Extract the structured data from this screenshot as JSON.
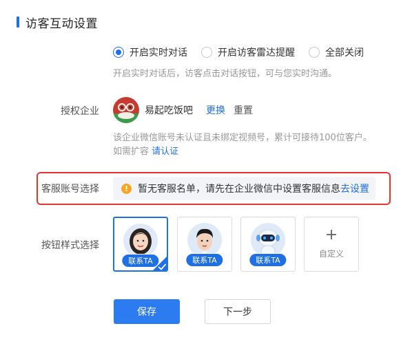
{
  "section": {
    "title": "访客互动设置"
  },
  "mode": {
    "options": [
      {
        "label": "开启实时对话",
        "checked": true
      },
      {
        "label": "开启访客雷达提醒",
        "checked": false
      },
      {
        "label": "全部关闭",
        "checked": false
      }
    ],
    "hint": "开启实时对话后，访客点击对话按钮，可与您实时沟通。"
  },
  "enterprise": {
    "label": "授权企业",
    "name": "易起吃饭吧",
    "change": "更换",
    "reset": "重置",
    "hint_line1": "该企业微信账号未认证且未绑定视频号，累计可接待100位客户。",
    "hint_line2_prefix": "如需扩容",
    "hint_line2_link": "请认证"
  },
  "service_account": {
    "label": "客服账号选择",
    "notice": "暂无客服名单，请先在企业微信中设置客服信息",
    "notice_link": "去设置",
    "warn_icon": "!"
  },
  "button_style": {
    "label": "按钮样式选择",
    "cards": [
      {
        "contact_label": "联系TA",
        "selected": true,
        "icon": "female-agent-avatar"
      },
      {
        "contact_label": "联系TA",
        "selected": false,
        "icon": "male-agent-avatar"
      },
      {
        "contact_label": "联系TA",
        "selected": false,
        "icon": "robot-avatar"
      }
    ],
    "custom": {
      "plus": "+",
      "label": "自定义"
    }
  },
  "actions": {
    "save": "保存",
    "next": "下一步"
  },
  "colors": {
    "accent": "#1f6fe5",
    "warning": "#f5a623",
    "highlight_border": "#e5332f"
  }
}
